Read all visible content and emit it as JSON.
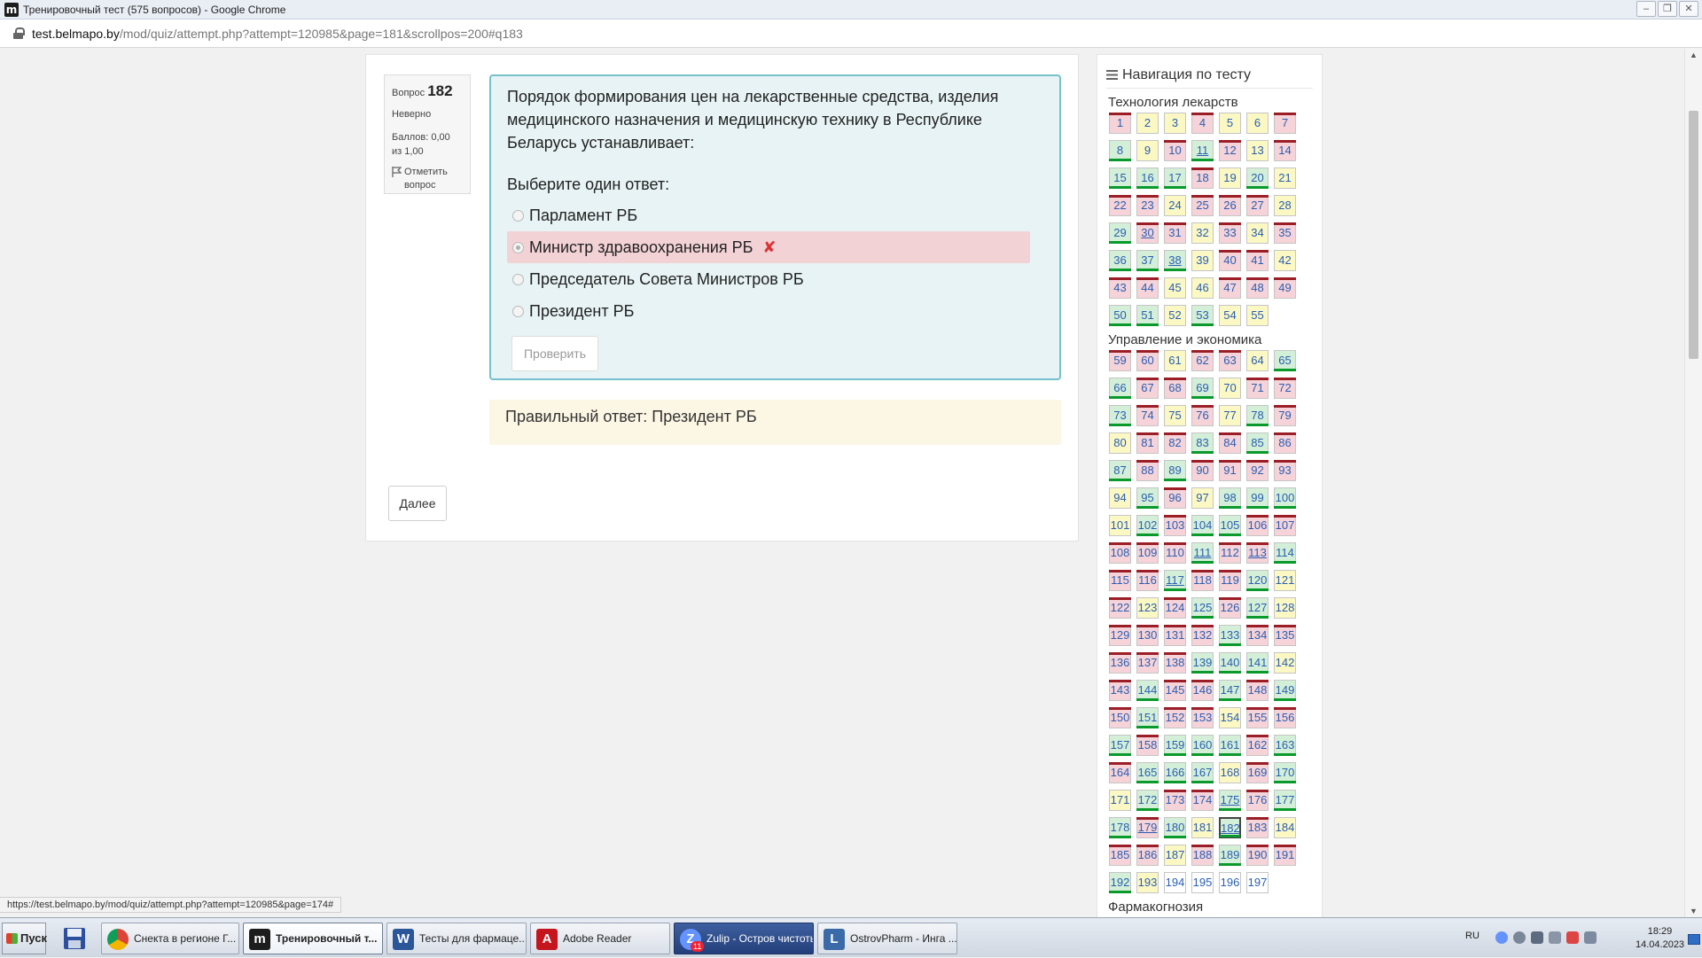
{
  "window": {
    "title": "Тренировочный тест (575 вопросов) - Google Chrome",
    "app_icon": "m",
    "url_domain": "test.belmapo.by",
    "url_path": "/mod/quiz/attempt.php?attempt=120985&page=181&scrollpos=200#q183",
    "controls": {
      "minimize": "–",
      "maximize": "❐",
      "close": "✕"
    }
  },
  "question": {
    "label": "Вопрос",
    "number": "182",
    "state": "Неверно",
    "grade": "Баллов: 0,00 из 1,00",
    "flag": "Отметить вопрос",
    "text": "Порядок формирования цен на лекарственные средства, изделия медицинского назначения и медицинскую технику в Республике Беларусь устанавливает:",
    "prompt": "Выберите один ответ:",
    "answers": [
      {
        "text": "Парламент РБ",
        "selected": false
      },
      {
        "text": "Министр здравоохранения РБ",
        "selected": true,
        "mark": "✘"
      },
      {
        "text": "Председатель Совета Министров РБ",
        "selected": false
      },
      {
        "text": "Президент РБ",
        "selected": false
      }
    ],
    "check_label": "Проверить",
    "feedback": "Правильный ответ: Президент РБ",
    "next_label": "Далее"
  },
  "nav": {
    "title": "Навигация по тесту",
    "sections": [
      {
        "title": "Технология лекарств",
        "start": 1,
        "states": "wppwppwcpwcwpwcccwpcpwwpwwwpcwwpwpwcccpwwpwwppwwwccpcpp"
      },
      {
        "title": "Управление и экономика",
        "start": 59,
        "states": "wwpwwpccwwcpwwcwpwpcwpwwcwcwcwcwwwwpcwpcccpcwccwwwwwcwwcwwcwwcpwpwcwcpwwwwcwwwwwcccpwcwwcwcwcwwpwwcwcccwcwcccpwcpcwwcwccwcpcwpwwpwcwwcpnnnn"
      }
    ],
    "current": 182,
    "underlined": [
      11,
      30,
      38,
      111,
      113,
      117,
      175,
      179,
      182
    ],
    "next_section_partial": "Фармакогнозия"
  },
  "statusbar": "https://test.belmapo.by/mod/quiz/attempt.php?attempt=120985&page=174#",
  "taskbar": {
    "start": "Пуск",
    "tasks": [
      {
        "label": "Снекта в регионе Г...",
        "icon": "chrome-icon"
      },
      {
        "label": "Тренировочный т...",
        "icon": "moodle-icon",
        "active": true
      },
      {
        "label": "Тесты для фармаце...",
        "icon": "word-icon"
      },
      {
        "label": "Adobe Reader",
        "icon": "pdf-icon"
      },
      {
        "label": "Zulip - Остров чистоты",
        "icon": "zulip-icon",
        "badge": "11"
      },
      {
        "label": "OstrovPharm - Инга ...",
        "icon": "ostrov-icon"
      }
    ],
    "tray": {
      "lang": "RU",
      "time": "18:29",
      "date": "14.04.2023"
    }
  }
}
